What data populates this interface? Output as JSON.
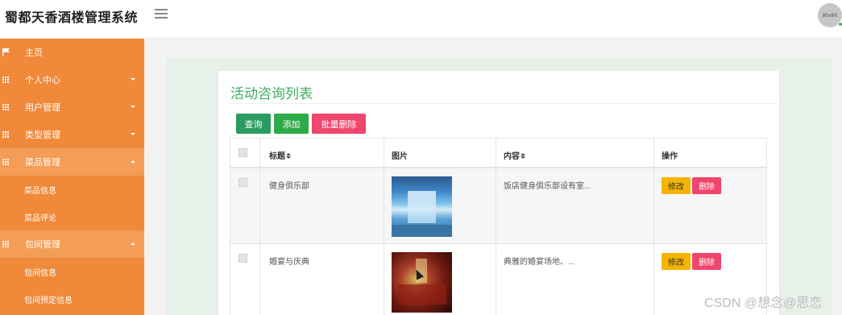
{
  "app": {
    "title": "蜀都天香酒楼管理系统",
    "avatar_text": "80x80"
  },
  "sidebar": {
    "items": [
      {
        "label": "主页",
        "icon": "flag-icon"
      },
      {
        "label": "个人中心",
        "icon": "grid-icon"
      },
      {
        "label": "用户管理",
        "icon": "grid-icon"
      },
      {
        "label": "类型管理",
        "icon": "grid-icon"
      },
      {
        "label": "菜品管理",
        "icon": "grid-icon"
      },
      {
        "label": "菜品信息"
      },
      {
        "label": "菜品评论"
      },
      {
        "label": "包间管理",
        "icon": "grid-icon"
      },
      {
        "label": "包间信息"
      },
      {
        "label": "包间预定信息"
      }
    ]
  },
  "page": {
    "title": "活动咨询列表",
    "toolbar": {
      "query": "查询",
      "add": "添加",
      "bulk_delete": "批量删除"
    },
    "table": {
      "headers": {
        "title": "标题",
        "image": "图片",
        "content": "内容",
        "actions": "操作"
      },
      "rows": [
        {
          "title": "健身俱乐部",
          "content": "饭店健身俱乐部设有室...",
          "edit": "修改",
          "delete": "删除"
        },
        {
          "title": "婚宴与庆典",
          "content": "典雅的婚宴场地、...",
          "edit": "修改",
          "delete": "删除"
        }
      ]
    }
  },
  "watermark": "CSDN @想念@思恋",
  "colors": {
    "sidebar": "#f0893a",
    "title_green": "#3fae5c",
    "query": "#2a9c61",
    "add": "#2eaa48",
    "delete": "#f0456c",
    "edit": "#f6b400"
  }
}
